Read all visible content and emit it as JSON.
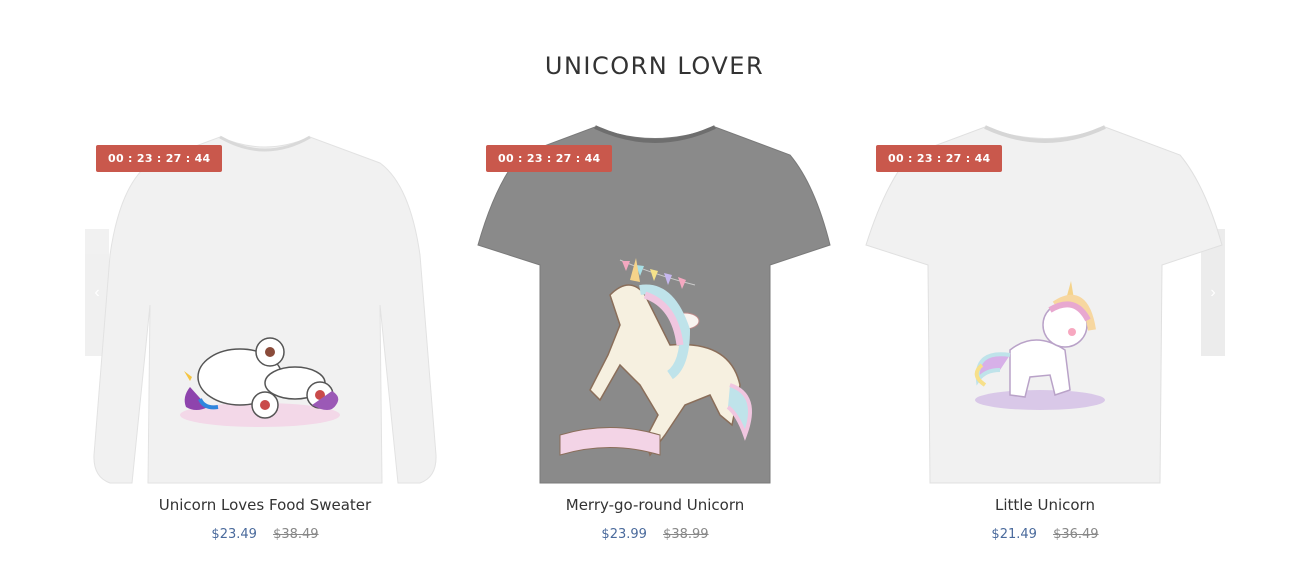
{
  "section": {
    "title": "UNICORN LOVER"
  },
  "carousel": {
    "prev_icon": "chevron-left-icon",
    "next_icon": "chevron-right-icon",
    "prev_glyph": "‹",
    "next_glyph": "›"
  },
  "products": [
    {
      "name": "Unicorn Loves Food Sweater",
      "price": "$23.49",
      "old_price": "$38.49",
      "timer": "00 : 23 : 27 : 44",
      "shirt_color": "#f2f2f2",
      "shirt_type": "long-sleeve"
    },
    {
      "name": "Merry-go-round Unicorn",
      "price": "$23.99",
      "old_price": "$38.99",
      "timer": "00 : 23 : 27 : 44",
      "shirt_color": "#8a8a8a",
      "shirt_type": "t-shirt"
    },
    {
      "name": "Little Unicorn",
      "price": "$21.49",
      "old_price": "$36.49",
      "timer": "00 : 23 : 27 : 44",
      "shirt_color": "#f2f2f2",
      "shirt_type": "t-shirt"
    }
  ],
  "colors": {
    "timer_bg": "#c9584c",
    "price": "#4a6a9c",
    "old_price": "#888888"
  }
}
